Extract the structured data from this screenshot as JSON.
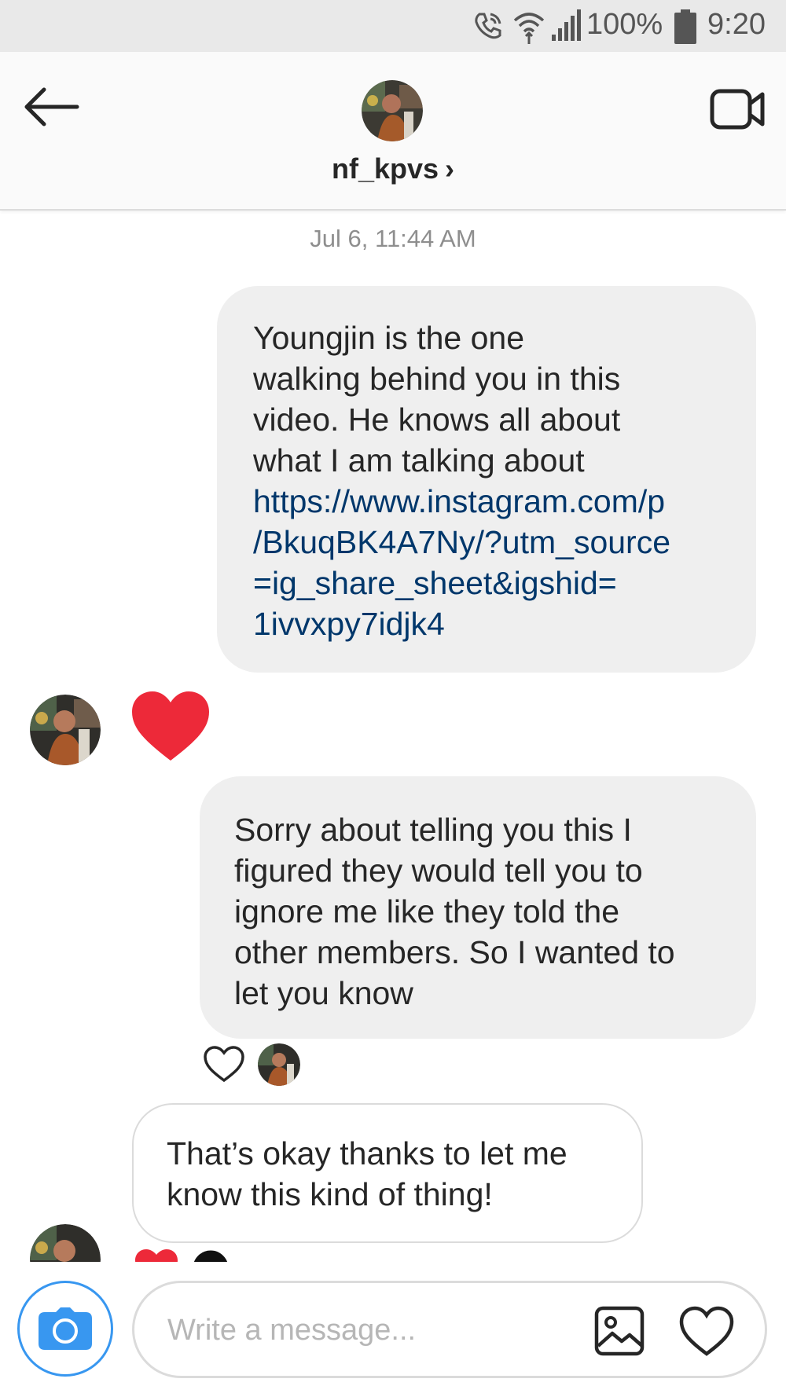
{
  "status_bar": {
    "battery_percent": "100%",
    "time": "9:20",
    "icons": [
      "wifi-calling-icon",
      "wifi-icon",
      "signal-icon",
      "battery-icon"
    ]
  },
  "header": {
    "username": "nf_kpvs",
    "chevron": "›",
    "icons": [
      "back-arrow-icon",
      "video-camera-icon"
    ]
  },
  "thread": {
    "timestamp": "Jul 6, 11:44 AM",
    "messages": [
      {
        "sender": "me",
        "lines": [
          "Youngjin is the one",
          "walking behind you in this",
          "video. He knows all about",
          "what I am talking about"
        ],
        "link_lines": [
          "https://www.instagram.com/p",
          "/BkuqBK4A7Ny/?utm_source",
          "=ig_share_sheet&igshid=",
          "1ivvxpy7idjk4"
        ]
      },
      {
        "sender": "them",
        "type": "heart-reaction"
      },
      {
        "sender": "me",
        "lines": [
          "Sorry about telling you this  I",
          "figured they would tell you to",
          "ignore me like they told the",
          "other members. So I wanted to",
          "let you know"
        ],
        "reactions": [
          "heart-outline"
        ]
      },
      {
        "sender": "them",
        "lines": [
          "That’s okay thanks to let me",
          "know this kind of thing!"
        ]
      }
    ]
  },
  "composer": {
    "placeholder": "Write a message...",
    "icons": [
      "camera-icon",
      "image-gallery-icon",
      "heart-icon"
    ]
  },
  "colors": {
    "link": "#00376b",
    "heart_red": "#ed2939",
    "camera_blue": "#3897f0",
    "bubble_grey": "#efefef"
  }
}
